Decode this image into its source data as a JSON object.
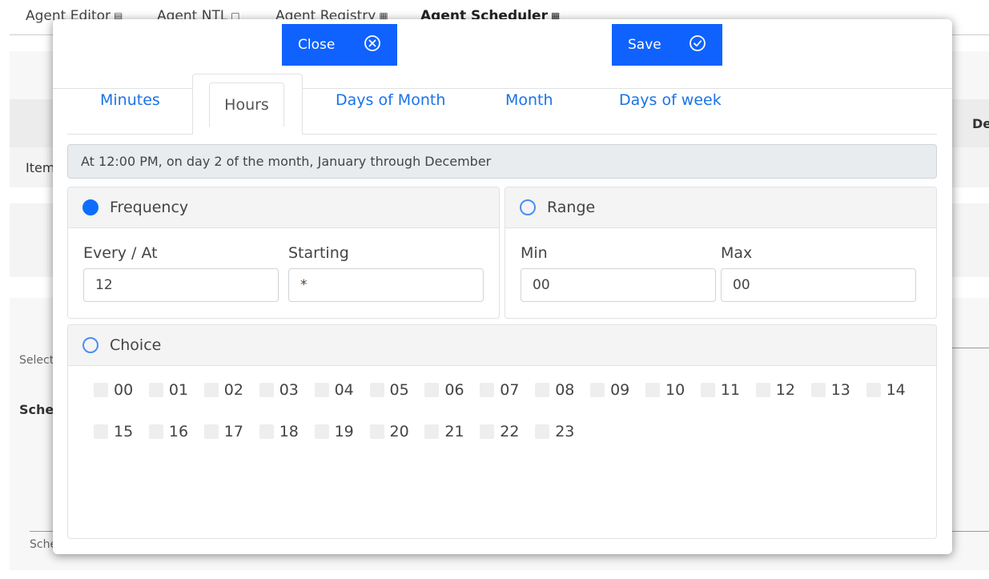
{
  "background": {
    "tabs": [
      {
        "label": "Agent Editor",
        "icon": "diagram-icon"
      },
      {
        "label": "Agent NTL",
        "icon": "code-icon"
      },
      {
        "label": "Agent Registry",
        "icon": "grid-icon"
      },
      {
        "label": "Agent Scheduler",
        "icon": "calendar-icon"
      }
    ],
    "item_text": "Item",
    "col_header": "De",
    "select_text": "Select",
    "schedule_title": "Sche",
    "schedule_footer": "Sche"
  },
  "modal": {
    "close_label": "Close",
    "save_label": "Save",
    "tabs": [
      "Minutes",
      "Hours",
      "Days of Month",
      "Month",
      "Days of week"
    ],
    "active_tab": "Hours",
    "description": "At 12:00 PM, on day 2 of the month, January through December",
    "frequency": {
      "title": "Frequency",
      "selected": true,
      "every_label": "Every / At",
      "every_value": "12",
      "starting_label": "Starting",
      "starting_value": "*"
    },
    "range": {
      "title": "Range",
      "selected": false,
      "min_label": "Min",
      "min_value": "00",
      "max_label": "Max",
      "max_value": "00"
    },
    "choice": {
      "title": "Choice",
      "selected": false,
      "options": [
        "00",
        "01",
        "02",
        "03",
        "04",
        "05",
        "06",
        "07",
        "08",
        "09",
        "10",
        "11",
        "12",
        "13",
        "14",
        "15",
        "16",
        "17",
        "18",
        "19",
        "20",
        "21",
        "22",
        "23"
      ]
    }
  },
  "colors": {
    "primary_button": "#0f62fe",
    "tab_link": "#1a73e8",
    "radio_selected": "#0d6efd"
  }
}
